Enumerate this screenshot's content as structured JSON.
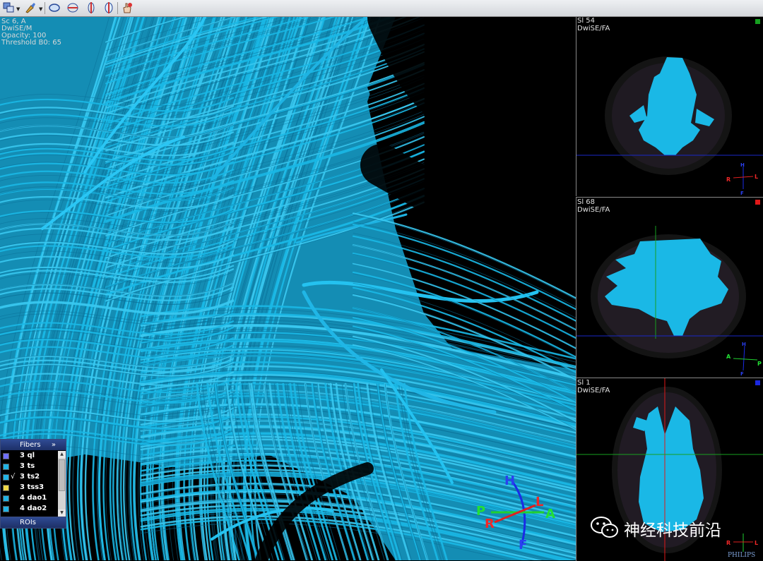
{
  "toolbar": {
    "icons": [
      "window-layout-icon",
      "paint-brush-icon",
      "ellipse-roi-icon",
      "plane-icon",
      "slice-cursor-icon",
      "rotate-icon",
      "hand-pointer-icon"
    ]
  },
  "main_view": {
    "overlay": {
      "line1": "Sc 6, A",
      "line2": "DwiSE/M",
      "line3": "Opacity: 100",
      "line4": "Threshold B0: 65"
    },
    "orientation": {
      "h": "H",
      "f": "F",
      "l": "L",
      "r": "R",
      "p": "P",
      "a": "A"
    },
    "fiber_color": "#1ab8e6"
  },
  "fibers_panel": {
    "title": "Fibers",
    "expand": "»",
    "items": [
      {
        "label": "3 ql",
        "checked": "",
        "color": "#7070ff"
      },
      {
        "label": "3 ts",
        "checked": "",
        "color": "#22b3e6"
      },
      {
        "label": "3 ts2",
        "checked": "√",
        "color": "#22b3e6"
      },
      {
        "label": "3 tss3",
        "checked": "",
        "color": "#f0d84a"
      },
      {
        "label": "4 dao1",
        "checked": "",
        "color": "#22b3e6"
      },
      {
        "label": "4 dao2",
        "checked": "",
        "color": "#22b3e6"
      }
    ]
  },
  "rois_panel": {
    "title": "ROIs"
  },
  "viewports": [
    {
      "slice": "Sl 54",
      "series": "DwiSE/FA",
      "marker_color": "#16a020",
      "orient": {
        "h": "H",
        "f": "F",
        "r": "R",
        "l": "L"
      }
    },
    {
      "slice": "Sl 68",
      "series": "DwiSE/FA",
      "marker_color": "#e01818",
      "orient": {
        "h": "H",
        "f": "F",
        "a": "A",
        "p": "P"
      }
    },
    {
      "slice": "Sl 1",
      "series": "DwiSE/FA",
      "marker_color": "#1a28e0",
      "orient": {
        "r": "R",
        "l": "L"
      }
    }
  ],
  "watermark": {
    "text": "神经科技前沿"
  },
  "brand": "PHILIPS"
}
